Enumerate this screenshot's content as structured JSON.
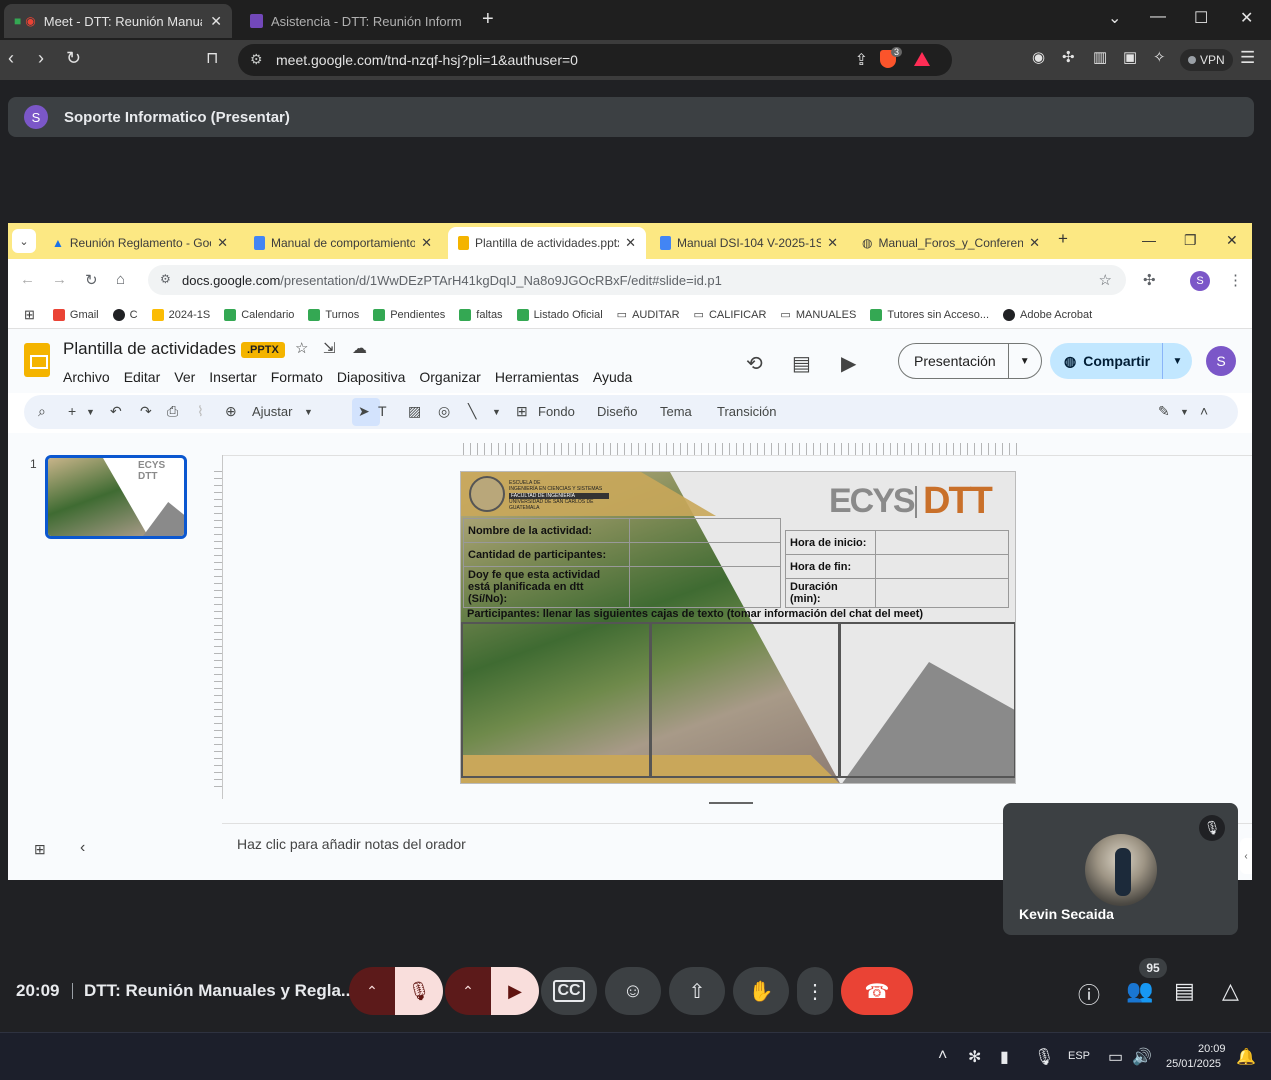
{
  "outer_browser": {
    "tabs": [
      {
        "label": "Meet - DTT: Reunión Manuales",
        "active": true
      },
      {
        "label": "Asistencia - DTT: Reunión Informativa",
        "active": false
      }
    ],
    "url": "meet.google.com/tnd-nzqf-hsj?pli=1&authuser=0",
    "brave_badge": "3",
    "vpn_label": "VPN"
  },
  "presenter": {
    "avatar_letter": "S",
    "label": "Soporte Informatico (Presentar)"
  },
  "inner_browser": {
    "tabs": [
      {
        "label": "Reunión Reglamento - Google",
        "active": false
      },
      {
        "label": "Manual de comportamiento",
        "active": false
      },
      {
        "label": "Plantilla de actividades.pptx",
        "active": true
      },
      {
        "label": "Manual DSI-104 V-2025-1S",
        "active": false
      },
      {
        "label": "Manual_Foros_y_Conferencias",
        "active": false
      }
    ],
    "url_host": "docs.google.com",
    "url_path": "/presentation/d/1WwDEzPTArH41kgDqIJ_Na8o9JGOcRBxF/edit#slide=id.p1",
    "profile_letter": "S",
    "bookmarks": [
      {
        "label": "Gmail",
        "color": "#ea4335"
      },
      {
        "label": "C",
        "color": "#202124"
      },
      {
        "label": "2024-1S",
        "color": "#34a853"
      },
      {
        "label": "Calendario",
        "color": "#34a853"
      },
      {
        "label": "Turnos",
        "color": "#34a853"
      },
      {
        "label": "Pendientes",
        "color": "#34a853"
      },
      {
        "label": "faltas",
        "color": "#34a853"
      },
      {
        "label": "Listado Oficial",
        "color": "#34a853"
      },
      {
        "label": "AUDITAR",
        "color": "folder"
      },
      {
        "label": "CALIFICAR",
        "color": "folder"
      },
      {
        "label": "MANUALES",
        "color": "folder"
      },
      {
        "label": "Tutores sin Acceso...",
        "color": "#34a853"
      },
      {
        "label": "Adobe Acrobat",
        "color": "#202124"
      }
    ]
  },
  "slides": {
    "title": "Plantilla de actividades",
    "badge": ".PPTX",
    "menus": [
      "Archivo",
      "Editar",
      "Ver",
      "Insertar",
      "Formato",
      "Diapositiva",
      "Organizar",
      "Herramientas",
      "Ayuda"
    ],
    "present_label": "Presentación",
    "share_label": "Compartir",
    "account_letter": "S",
    "toolbar": {
      "zoom": "Ajustar",
      "bg": "Fondo",
      "layout": "Diseño",
      "theme": "Tema",
      "transition": "Transición"
    },
    "slide_number": "1",
    "notes_placeholder": "Haz clic para añadir notas del orador",
    "slide": {
      "school_lines": [
        "ESCUELA DE",
        "INGENIERÍA EN CIENCIAS Y SISTEMAS",
        "FACULTAD DE INGENIERÍA",
        "UNIVERSIDAD DE SAN CARLOS DE GUATEMALA"
      ],
      "logo_left": "ECYS",
      "logo_right": "DTT",
      "rows_left": [
        "Nombre de la actividad:",
        "Cantidad de participantes:",
        "Doy fe que esta actividad está planificada en dtt (Sí/No):"
      ],
      "rows_right": [
        "Hora de inicio:",
        "Hora de fin:",
        "Duración (min):"
      ],
      "participants": "Participantes: llenar las siguientes cajas de texto (tomar información del chat del meet)"
    }
  },
  "participant_tile": {
    "name": "Kevin Secaida"
  },
  "meet_bar": {
    "time": "20:09",
    "title": "DTT: Reunión Manuales y Regla...",
    "people_count": "95"
  },
  "taskbar": {
    "lang": "ESP",
    "time": "20:09",
    "date": "25/01/2025"
  }
}
